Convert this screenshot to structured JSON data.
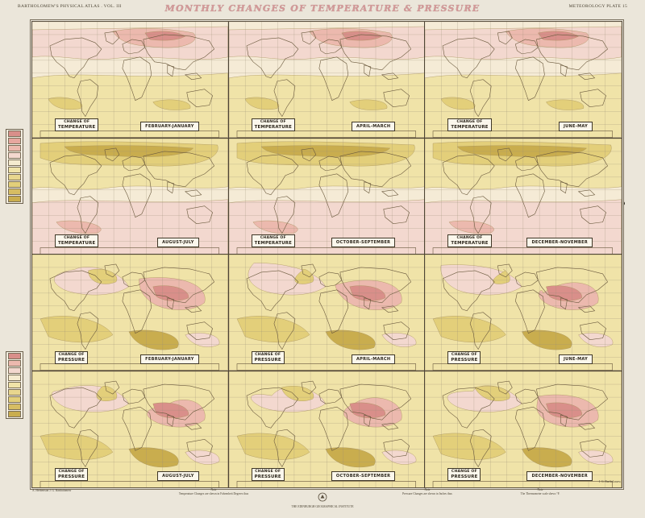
{
  "header": {
    "left": "BARTHOLOMEW'S PHYSICAL ATLAS . VOL. III",
    "title": "MONTHLY CHANGES OF TEMPERATURE & PRESSURE",
    "right": "METEOROLOGY PLATE 15"
  },
  "panels": [
    {
      "type_small": "CHANGE OF",
      "type_big": "TEMPERATURE",
      "period": "FEBRUARY-JANUARY",
      "tint": "pink"
    },
    {
      "type_small": "CHANGE OF",
      "type_big": "TEMPERATURE",
      "period": "APRIL-MARCH",
      "tint": "pink"
    },
    {
      "type_small": "CHANGE OF",
      "type_big": "TEMPERATURE",
      "period": "JUNE-MAY",
      "tint": "pink"
    },
    {
      "type_small": "CHANGE OF",
      "type_big": "TEMPERATURE",
      "period": "AUGUST-JULY",
      "tint": "ochre"
    },
    {
      "type_small": "CHANGE OF",
      "type_big": "TEMPERATURE",
      "period": "OCTOBER-SEPTEMBER",
      "tint": "ochre"
    },
    {
      "type_small": "CHANGE OF",
      "type_big": "TEMPERATURE",
      "period": "DECEMBER-NOVEMBER",
      "tint": "ochre"
    },
    {
      "type_small": "CHANGE OF",
      "type_big": "PRESSURE",
      "period": "FEBRUARY-JANUARY",
      "tint": "mixed"
    },
    {
      "type_small": "CHANGE OF",
      "type_big": "PRESSURE",
      "period": "APRIL-MARCH",
      "tint": "mixed"
    },
    {
      "type_small": "CHANGE OF",
      "type_big": "PRESSURE",
      "period": "JUNE-MAY",
      "tint": "mixed"
    },
    {
      "type_small": "CHANGE OF",
      "type_big": "PRESSURE",
      "period": "AUGUST-JULY",
      "tint": "mixed"
    },
    {
      "type_small": "CHANGE OF",
      "type_big": "PRESSURE",
      "period": "OCTOBER-SEPTEMBER",
      "tint": "mixed"
    },
    {
      "type_small": "CHANGE OF",
      "type_big": "PRESSURE",
      "period": "DECEMBER-NOVEMBER",
      "tint": "mixed"
    }
  ],
  "colors": {
    "rise_strong": "#d98f8a",
    "rise": "#ecb9ae",
    "rise_light": "#f3d8cf",
    "fall_light": "#f0e3a8",
    "fall": "#e3cf7a",
    "fall_strong": "#c9ad4e",
    "land_outline": "#6b5a3e",
    "graticule": "#9c8f78"
  },
  "footer": {
    "left": "A. Herbertson  J. G. Bartholomew",
    "note_left_title": "Note",
    "note_left": "Temperature Changes are shewn in Fahrenheit Degrees thus",
    "note_mid_title": "Note",
    "note_mid": "Pressure Changes are shewn in Inches thus",
    "note_right_title": "Note",
    "note_right": "The Thermometer scale shews °F.",
    "publisher": "THE EDINBURGH GEOGRAPHICAL INSTITUTE",
    "right": "J. G. Bartholomew"
  }
}
